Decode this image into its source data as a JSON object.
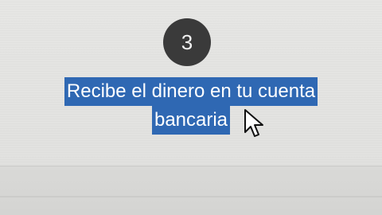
{
  "step": {
    "number": "3",
    "text_line1": "Recibe el dinero en tu cuenta",
    "text_line2": "bancaria"
  },
  "cursor": {
    "icon": "mouse-pointer-arrow-icon"
  },
  "colors": {
    "selection": "#2f68b3",
    "circle": "#3a3a3a",
    "background": "#e4e4e2"
  }
}
